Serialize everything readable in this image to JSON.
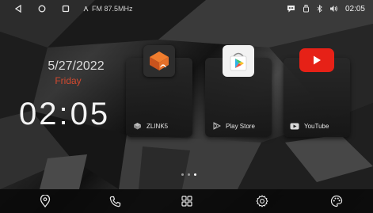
{
  "status_bar": {
    "radio_text": "FM 87.5MHz",
    "time": "02:05",
    "icons": [
      "back-icon",
      "home-icon",
      "recents-icon",
      "radio-icon",
      "message-icon",
      "usb-icon",
      "bluetooth-icon",
      "volume-icon"
    ]
  },
  "clock": {
    "date": "5/27/2022",
    "day": "Friday",
    "time": "02:05"
  },
  "apps": [
    {
      "label": "ZLINK5",
      "icon": "zlink-icon"
    },
    {
      "label": "Play Store",
      "icon": "play-store-icon"
    },
    {
      "label": "YouTube",
      "icon": "youtube-icon"
    }
  ],
  "pager": {
    "count": 3,
    "active": 2
  },
  "nav": [
    "location-icon",
    "phone-icon",
    "apps-grid-icon",
    "settings-icon",
    "palette-icon"
  ],
  "colors": {
    "day_accent": "#d2492f",
    "youtube_red": "#e62117",
    "zlink_orange": "#e4702a"
  }
}
